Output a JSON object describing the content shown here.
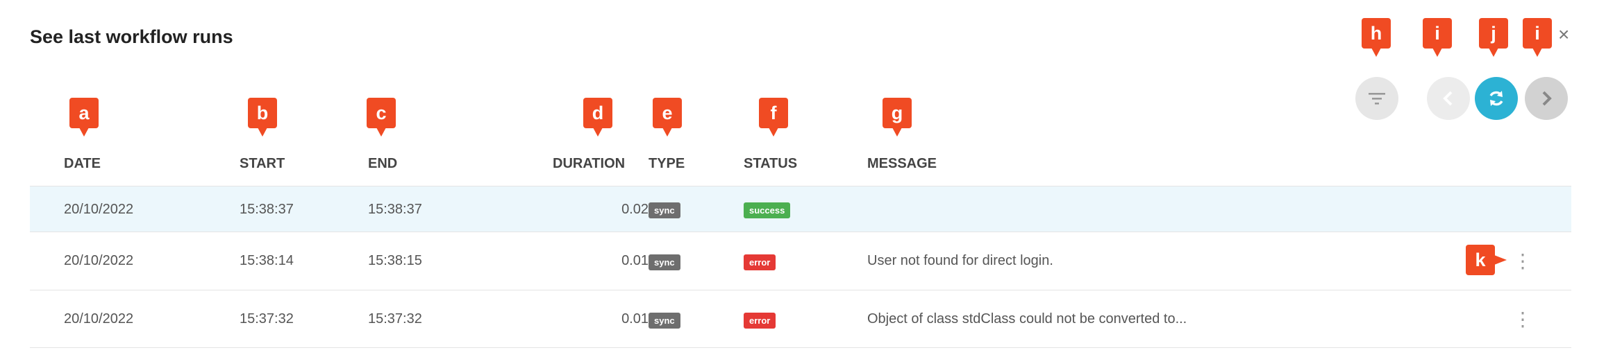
{
  "header": {
    "title": "See last workflow runs",
    "close": "×"
  },
  "icons": {
    "filter": "filter-icon",
    "prev": "chevron-left-icon",
    "refresh": "refresh-icon",
    "next": "chevron-right-icon",
    "more": "more-vertical-icon"
  },
  "colors": {
    "accent": "#2cb2d4",
    "marker": "#f04b23",
    "success": "#4caf50",
    "error": "#e53935",
    "highlight_row": "#ecf7fc"
  },
  "markers": {
    "a": "a",
    "b": "b",
    "c": "c",
    "d": "d",
    "e": "e",
    "f": "f",
    "g": "g",
    "h": "h",
    "i": "i",
    "j": "j",
    "k": "k"
  },
  "columns": {
    "date": "DATE",
    "start": "START",
    "end": "END",
    "duration": "DURATION",
    "type": "TYPE",
    "status": "STATUS",
    "message": "MESSAGE"
  },
  "rows": [
    {
      "date": "20/10/2022",
      "start": "15:38:37",
      "end": "15:38:37",
      "duration": "0.02s",
      "type": "sync",
      "status": "success",
      "message": "",
      "more": ""
    },
    {
      "date": "20/10/2022",
      "start": "15:38:14",
      "end": "15:38:15",
      "duration": "0.01s",
      "type": "sync",
      "status": "error",
      "message": "User not found for direct login.",
      "more": "⋮"
    },
    {
      "date": "20/10/2022",
      "start": "15:37:32",
      "end": "15:37:32",
      "duration": "0.01s",
      "type": "sync",
      "status": "error",
      "message": "Object of class stdClass could not be converted to...",
      "more": "⋮"
    }
  ]
}
